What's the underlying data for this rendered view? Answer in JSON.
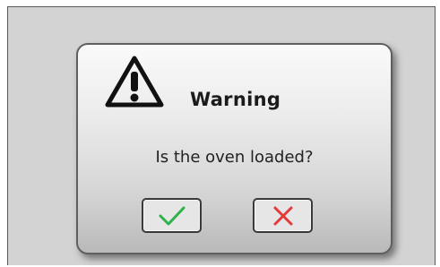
{
  "dialog": {
    "title": "Warning",
    "message": "Is the oven loaded?",
    "icons": {
      "warning": "warning-triangle-icon",
      "confirm": "checkmark-icon",
      "cancel": "close-icon"
    },
    "colors": {
      "confirm": "#2db24a",
      "cancel": "#e23a3a",
      "icon": "#111111"
    }
  }
}
